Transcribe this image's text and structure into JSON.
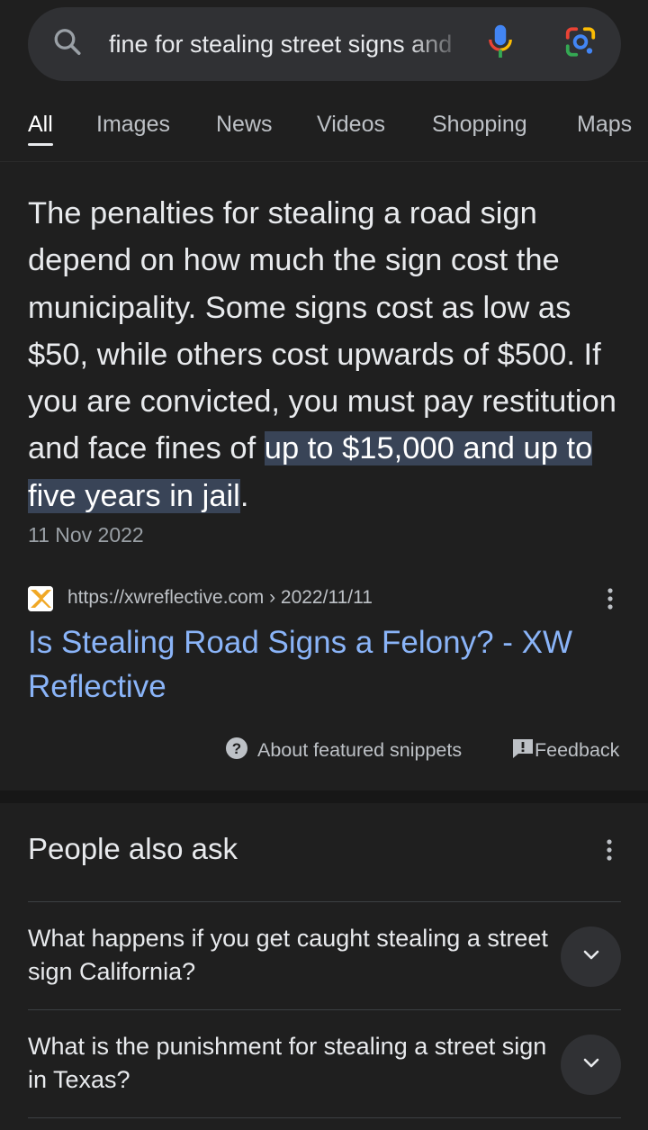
{
  "search": {
    "query": "fine for stealing street signs and",
    "icons": {
      "search": "search-icon",
      "mic": "mic-icon",
      "lens": "google-lens-icon"
    }
  },
  "tabs": [
    {
      "label": "All",
      "active": true
    },
    {
      "label": "Images",
      "active": false
    },
    {
      "label": "News",
      "active": false
    },
    {
      "label": "Videos",
      "active": false
    },
    {
      "label": "Shopping",
      "active": false
    },
    {
      "label": "Maps",
      "active": false
    }
  ],
  "snippet": {
    "answer_text": "The penalties for stealing a road sign depend on how much the sign cost the municipality. Some signs cost as low as $50, while others cost upwards of $500. If you are convicted, you must pay restitution and face fines of ",
    "answer_highlight": "up to $15,000 and up to five years in jail",
    "answer_end": ".",
    "date": "11 Nov 2022",
    "source_url": "https://xwreflective.com › 2022/11/11",
    "result_title": "Is Stealing Road Signs a Felony? - XW Reflective",
    "about_label": "About featured snippets",
    "feedback_label": "Feedback"
  },
  "people_also_ask": {
    "title": "People also ask",
    "questions": [
      "What happens if you get caught stealing a street sign California?",
      "What is the punishment for stealing a street sign in Texas?"
    ]
  },
  "colors": {
    "background": "#1f1f1f",
    "link": "#8ab4f8",
    "highlight": "#394457"
  }
}
